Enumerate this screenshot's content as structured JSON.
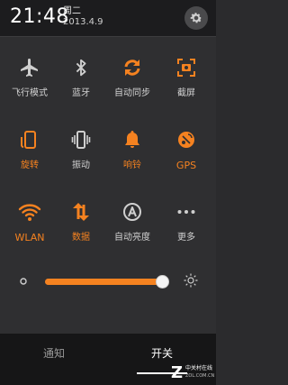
{
  "status_bar": {
    "time": "21:48",
    "weekday": "周二",
    "date": "2013.4.9",
    "settings_icon": "gear-icon"
  },
  "toggles": [
    [
      {
        "label": "飞行模式",
        "icon": "airplane-icon",
        "on": false
      },
      {
        "label": "蓝牙",
        "icon": "bluetooth-icon",
        "on": false
      },
      {
        "label": "自动同步",
        "icon": "sync-icon",
        "on": true
      },
      {
        "label": "截屏",
        "icon": "screenshot-icon",
        "on": true
      }
    ],
    [
      {
        "label": "旋转",
        "icon": "rotate-icon",
        "on": true
      },
      {
        "label": "振动",
        "icon": "vibrate-icon",
        "on": false
      },
      {
        "label": "响铃",
        "icon": "bell-icon",
        "on": true
      },
      {
        "label": "GPS",
        "icon": "gps-icon",
        "on": true
      }
    ],
    [
      {
        "label": "WLAN",
        "icon": "wifi-icon",
        "on": true
      },
      {
        "label": "数据",
        "icon": "data-icon",
        "on": true
      },
      {
        "label": "自动亮度",
        "icon": "auto-brightness-icon",
        "on": false
      },
      {
        "label": "更多",
        "icon": "more-icon",
        "on": false
      }
    ]
  ],
  "brightness": {
    "level": 0.98,
    "low_icon": "dim-icon",
    "high_icon": "brightness-icon"
  },
  "bottom_tabs": {
    "notify": "通知",
    "switches": "开关",
    "active": "switches"
  },
  "watermark": {
    "logo": "Z",
    "line1": "中关村在线",
    "line2": "ZOL.COM.CN"
  },
  "colors": {
    "accent": "#f58220",
    "off": "#cfcfcf",
    "panel": "#2f2f31"
  }
}
